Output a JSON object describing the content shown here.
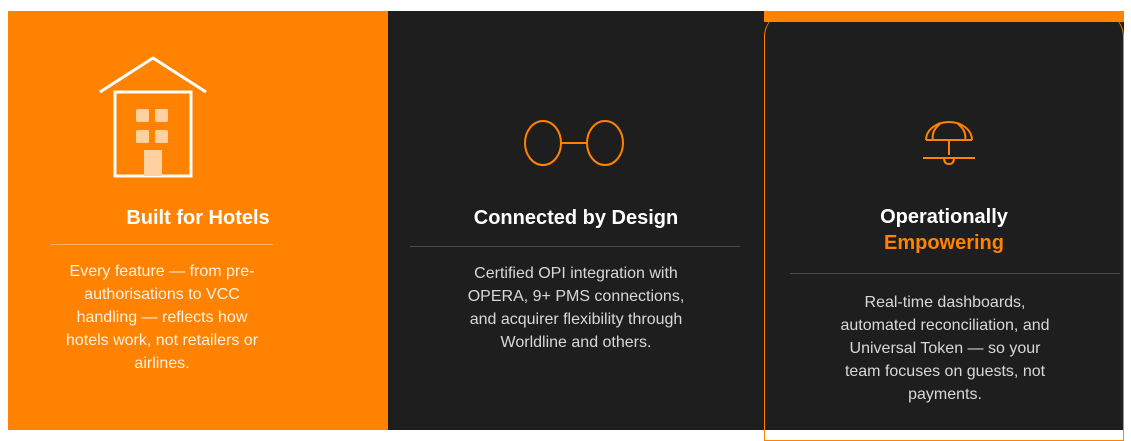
{
  "colors": {
    "accent": "#ff8200",
    "dark": "#1e1e1e",
    "text_light": "#ffffff"
  },
  "cards": [
    {
      "icon": "hotel-building-icon",
      "title": "Built for Hotels",
      "description": "Every feature — from pre-authorisations to VCC handling — reflects how hotels work, not retailers or airlines."
    },
    {
      "icon": "linked-rings-icon",
      "title": "Connected by Design",
      "description": "Certified OPI integration with OPERA, 9+ PMS connections, and acquirer flexibility through Worldline and others."
    },
    {
      "icon": "service-bell-umbrella-icon",
      "title": "Operationally",
      "title_accent": "Empowering",
      "description": "Real-time dashboards, automated reconciliation, and Universal Token — so your team focuses on guests, not payments."
    }
  ]
}
